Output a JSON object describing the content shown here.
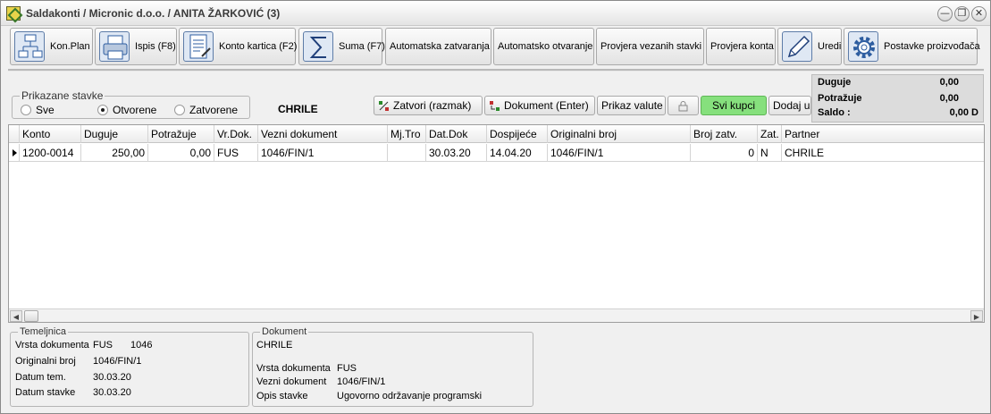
{
  "window": {
    "title": "Saldakonti / Micronic d.o.o. / ANITA ŽARKOVIĆ (3)",
    "minimize": "—",
    "restore": "❐",
    "close": "✕"
  },
  "toolbar": {
    "buttons": [
      {
        "label": "Kon.Plan",
        "icon": "org-chart-icon"
      },
      {
        "label": "Ispis (F8)",
        "icon": "printer-icon"
      },
      {
        "label": "Konto kartica (F2)",
        "icon": "document-form-icon"
      },
      {
        "label": "Suma (F7)",
        "icon": "sigma-icon"
      },
      {
        "label": "Automatska zatvaranja"
      },
      {
        "label": "Automatsko otvaranje"
      },
      {
        "label": "Provjera vezanih stavki"
      },
      {
        "label": "Provjera konta"
      },
      {
        "label": "Uredi",
        "icon": "pencil-icon"
      },
      {
        "label": "Postavke proizvođača",
        "icon": "gear-icon"
      }
    ]
  },
  "filter": {
    "legend": "Prikazane stavke",
    "options": [
      {
        "label": "Sve",
        "selected": false
      },
      {
        "label": "Otvorene",
        "selected": true
      },
      {
        "label": "Zatvorene",
        "selected": false
      }
    ]
  },
  "partner_name": "CHRILE",
  "actions": {
    "close": "Zatvori (razmak)",
    "document": "Dokument (Enter)",
    "currency": "Prikaz valute",
    "all_customers": "Svi kupci",
    "add": "Dodaj u"
  },
  "summary": {
    "duguje_label": "Duguje",
    "duguje_value": "0,00",
    "potrazuje_label": "Potražuje",
    "potrazuje_value": "0,00",
    "saldo_label": "Saldo :",
    "saldo_value": "0,00 D"
  },
  "grid": {
    "columns": [
      "Konto",
      "Duguje",
      "Potražuje",
      "Vr.Dok.",
      "Vezni dokument",
      "Mj.Tro",
      "Dat.Dok",
      "Dospijeće",
      "Originalni broj",
      "Broj zatv.",
      "Zat.",
      "Partner"
    ],
    "rows": [
      [
        "1200-0014",
        "250,00",
        "0,00",
        "FUS",
        "1046/FIN/1",
        "",
        "30.03.20",
        "14.04.20",
        "1046/FIN/1",
        "0",
        "N",
        "CHRILE"
      ]
    ]
  },
  "temeljnica": {
    "legend": "Temeljnica",
    "vrsta_label": "Vrsta dokumenta",
    "vrsta_value": "FUS",
    "vrsta_num": "1046",
    "orig_label": "Originalni broj",
    "orig_value": "1046/FIN/1",
    "datum_tem_label": "Datum tem.",
    "datum_tem_value": "30.03.20",
    "datum_stavke_label": "Datum stavke",
    "datum_stavke_value": "30.03.20"
  },
  "dokument": {
    "legend": "Dokument",
    "partner": "CHRILE",
    "vrsta_label": "Vrsta dokumenta",
    "vrsta_value": "FUS",
    "vezni_label": "Vezni dokument",
    "vezni_value": "1046/FIN/1",
    "opis_label": "Opis stavke",
    "opis_value": "Ugovorno održavanje programski"
  }
}
